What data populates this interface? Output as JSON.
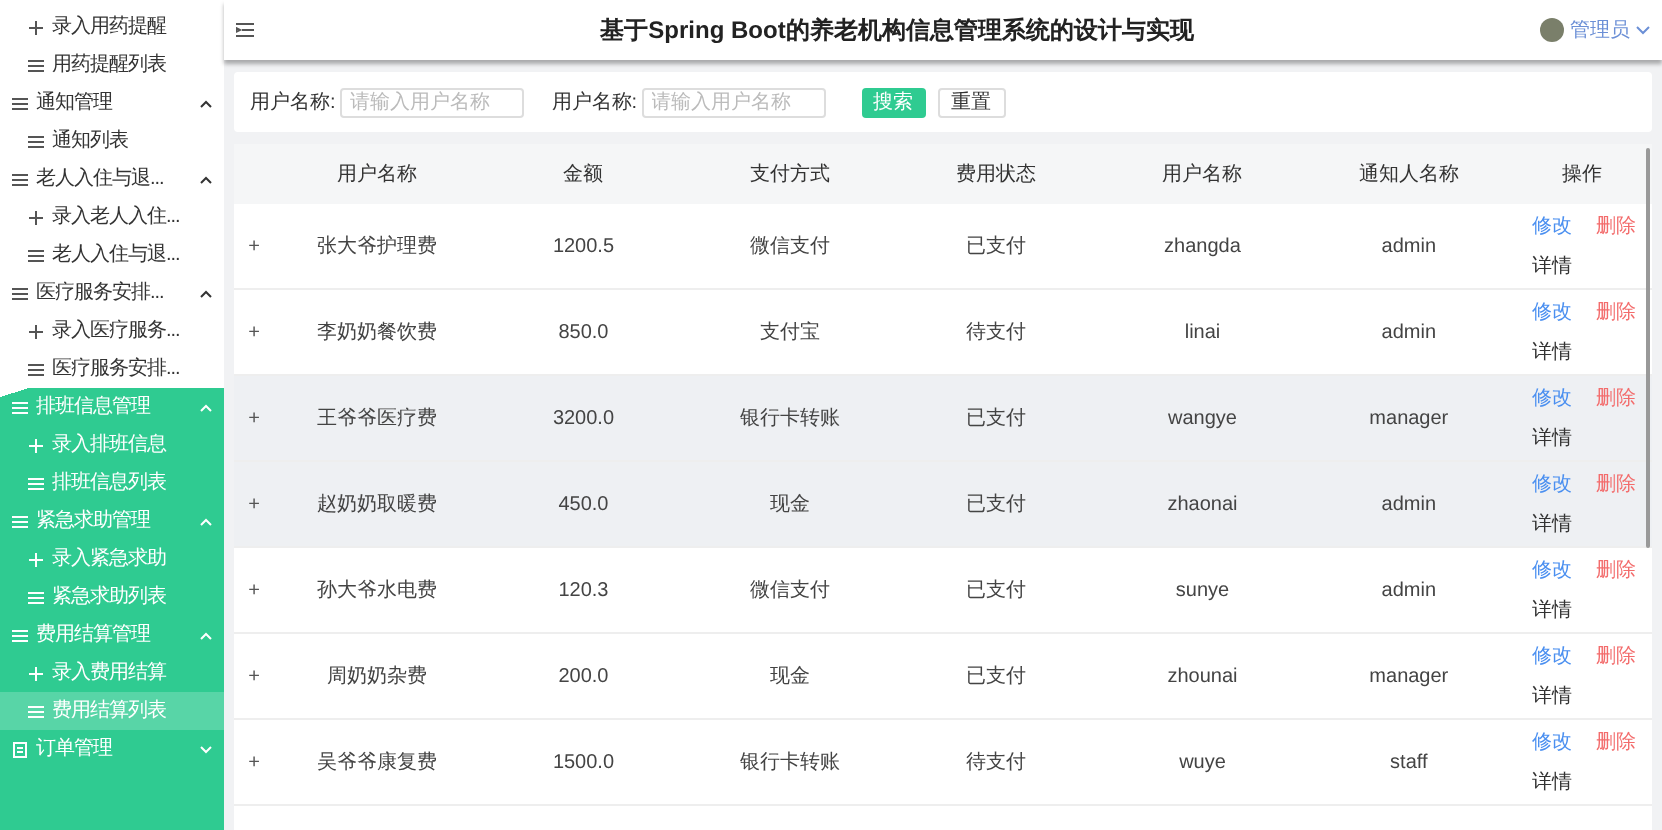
{
  "sidebar": {
    "groups": [
      {
        "children": [
          {
            "label": "录入用药提醒",
            "kind": "add",
            "selected": false
          },
          {
            "label": "用药提醒列表",
            "kind": "list",
            "selected": false
          }
        ]
      },
      {
        "label": "通知管理",
        "kind": "list",
        "expanded": true,
        "children": [
          {
            "label": "通知列表",
            "kind": "list",
            "selected": false
          }
        ]
      },
      {
        "label": "老人入住与退...",
        "kind": "list",
        "expanded": true,
        "children": [
          {
            "label": "录入老人入住...",
            "kind": "add",
            "selected": false
          },
          {
            "label": "老人入住与退...",
            "kind": "list",
            "selected": false
          }
        ]
      },
      {
        "label": "医疗服务安排...",
        "kind": "list",
        "expanded": true,
        "children": [
          {
            "label": "录入医疗服务...",
            "kind": "add",
            "selected": false
          },
          {
            "label": "医疗服务安排...",
            "kind": "list",
            "selected": false
          }
        ]
      },
      {
        "label": "排班信息管理",
        "kind": "list",
        "expanded": true,
        "children": [
          {
            "label": "录入排班信息",
            "kind": "add",
            "selected": false
          },
          {
            "label": "排班信息列表",
            "kind": "list",
            "selected": false
          }
        ]
      },
      {
        "label": "紧急求助管理",
        "kind": "list",
        "expanded": true,
        "children": [
          {
            "label": "录入紧急求助",
            "kind": "add",
            "selected": false
          },
          {
            "label": "紧急求助列表",
            "kind": "list",
            "selected": false
          }
        ]
      },
      {
        "label": "费用结算管理",
        "kind": "list",
        "expanded": true,
        "children": [
          {
            "label": "录入费用结算",
            "kind": "add",
            "selected": false
          },
          {
            "label": "费用结算列表",
            "kind": "list",
            "selected": true
          }
        ]
      },
      {
        "label": "订单管理",
        "kind": "order",
        "expanded": false
      }
    ]
  },
  "header": {
    "title": "基于Spring Boot的养老机构信息管理系统的设计与实现",
    "user": "管理员"
  },
  "search": {
    "fields": [
      {
        "label": "用户名称:",
        "placeholder": "请输入用户名称"
      },
      {
        "label": "用户名称:",
        "placeholder": "请输入用户名称"
      }
    ],
    "buttons": [
      {
        "label": "搜索",
        "kind": "primary"
      },
      {
        "label": "重置",
        "kind": "plain"
      }
    ]
  },
  "table": {
    "columns": [
      "用户名称",
      "金额",
      "支付方式",
      "费用状态",
      "用户名称",
      "通知人名称",
      "操作"
    ],
    "rows": [
      {
        "expand": "+",
        "cells": [
          "张大爷护理费",
          "1200.5",
          "微信支付",
          "已支付",
          "zhangda",
          "admin"
        ],
        "actions": [
          "修改",
          "删除",
          "详情"
        ],
        "highlighted": false
      },
      {
        "expand": "+",
        "cells": [
          "李奶奶餐饮费",
          "850.0",
          "支付宝",
          "待支付",
          "linai",
          "admin"
        ],
        "actions": [
          "修改",
          "删除",
          "详情"
        ],
        "highlighted": false
      },
      {
        "expand": "+",
        "cells": [
          "王爷爷医疗费",
          "3200.0",
          "银行卡转账",
          "已支付",
          "wangye",
          "manager"
        ],
        "actions": [
          "修改",
          "删除",
          "详情"
        ],
        "highlighted": true
      },
      {
        "expand": "+",
        "cells": [
          "赵奶奶取暖费",
          "450.0",
          "现金",
          "已支付",
          "zhaonai",
          "admin"
        ],
        "actions": [
          "修改",
          "删除",
          "详情"
        ],
        "highlighted": true
      },
      {
        "expand": "+",
        "cells": [
          "孙大爷水电费",
          "120.3",
          "微信支付",
          "已支付",
          "sunye",
          "admin"
        ],
        "actions": [
          "修改",
          "删除",
          "详情"
        ],
        "highlighted": false
      },
      {
        "expand": "+",
        "cells": [
          "周奶奶杂费",
          "200.0",
          "现金",
          "已支付",
          "zhounai",
          "manager"
        ],
        "actions": [
          "修改",
          "删除",
          "详情"
        ],
        "highlighted": false
      },
      {
        "expand": "+",
        "cells": [
          "吴爷爷康复费",
          "1500.0",
          "银行卡转账",
          "待支付",
          "wuye",
          "staff"
        ],
        "actions": [
          "修改",
          "删除",
          "详情"
        ],
        "highlighted": false
      }
    ]
  }
}
